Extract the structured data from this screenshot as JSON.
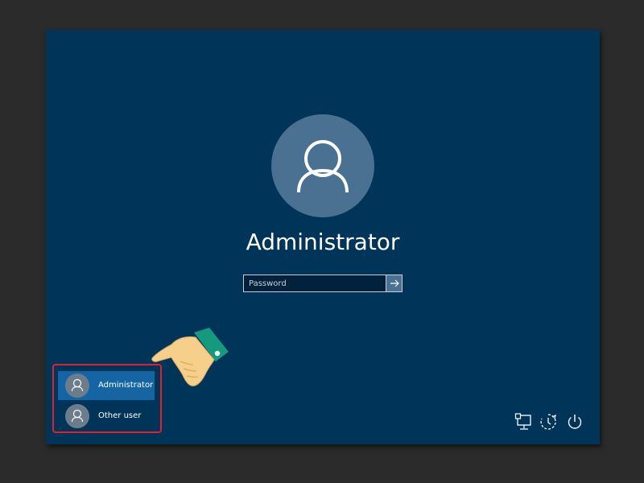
{
  "login": {
    "username": "Administrator",
    "password_placeholder": "Password"
  },
  "user_list": [
    {
      "label": "Administrator",
      "selected": true
    },
    {
      "label": "Other user",
      "selected": false
    }
  ],
  "tray_icons": [
    "network-icon",
    "ease-of-access-icon",
    "power-icon"
  ],
  "colors": {
    "background": "#003459",
    "avatar": "#4a7191",
    "selected_user": "#1565a5",
    "highlight": "#e0202f"
  }
}
